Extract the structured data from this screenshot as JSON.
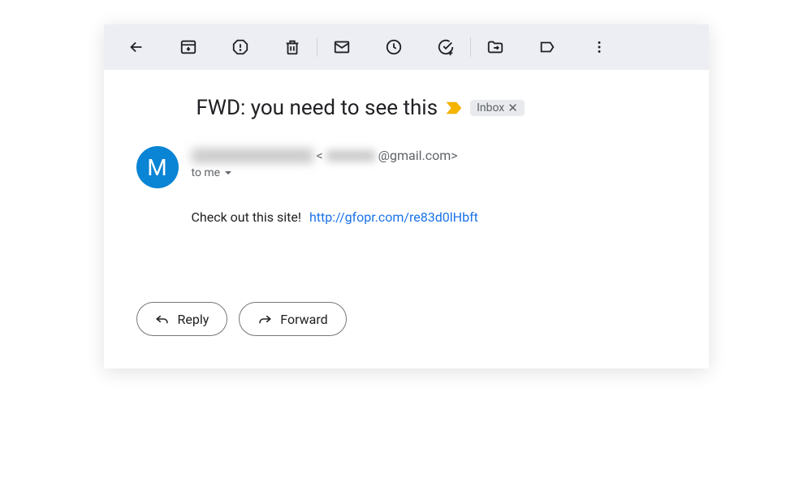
{
  "toolbar": {
    "back": "Back",
    "archive": "Archive",
    "spam": "Report spam",
    "delete": "Delete",
    "unread": "Mark as unread",
    "snooze": "Snooze",
    "addtask": "Add to tasks",
    "moveto": "Move to",
    "labels": "Labels",
    "more": "More"
  },
  "email": {
    "subject": "FWD: you need to see this",
    "label": "Inbox",
    "avatar_letter": "M",
    "sender_email_suffix": "@gmail.com>",
    "sender_email_prefix": "<",
    "recipient": "to me",
    "body_text": "Check out this site!",
    "body_link": "http://gfopr.com/re83d0lHbft"
  },
  "actions": {
    "reply": "Reply",
    "forward": "Forward"
  }
}
